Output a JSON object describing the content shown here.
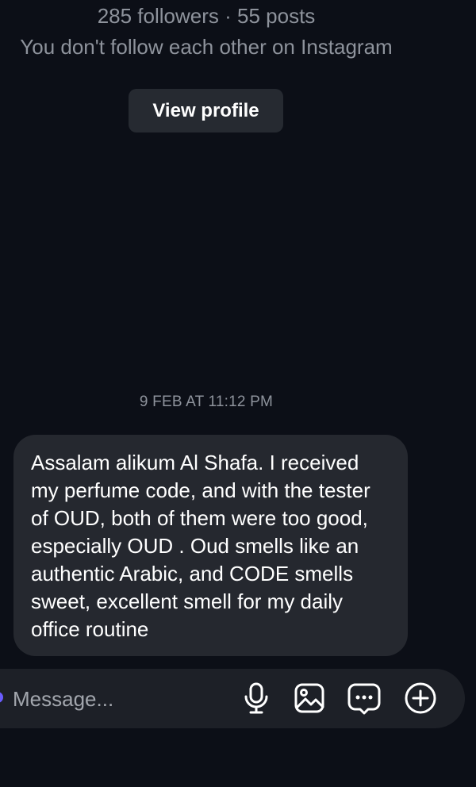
{
  "profile": {
    "stats": "285 followers · 55 posts",
    "follow_status": "You don't follow each other on Instagram",
    "view_profile_label": "View profile"
  },
  "thread": {
    "timestamp": "9 FEB AT 11:12 PM",
    "messages": [
      {
        "direction": "incoming",
        "text": "Assalam alikum Al Shafa. I received my perfume code, and with the tester of OUD, both of them were too good, especially OUD . Oud smells like an authentic Arabic, and CODE smells sweet, excellent smell for my daily office routine"
      }
    ]
  },
  "composer": {
    "placeholder": "Message...",
    "value": "",
    "icons": [
      "microphone-icon",
      "gallery-icon",
      "sticker-icon",
      "add-icon"
    ]
  },
  "colors": {
    "background": "#0c0f17",
    "bubble": "#25282f",
    "button": "#262a31",
    "composer": "#1d2027",
    "muted_text": "#8e939c",
    "accent": "#6a5cff"
  }
}
